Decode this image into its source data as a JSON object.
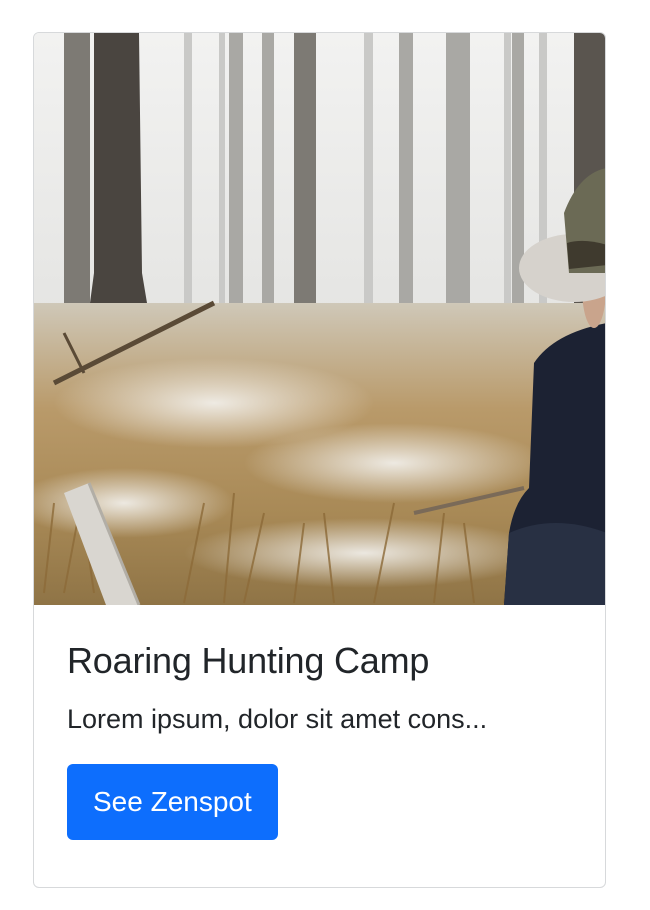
{
  "card": {
    "image_alt": "Person in a hat sitting in a snowy forest",
    "title": "Roaring Hunting Camp",
    "description": "Lorem ipsum, dolor sit amet cons...",
    "button_label": "See Zenspot"
  },
  "colors": {
    "button_bg": "#0d6efd",
    "text": "#212529",
    "border": "#d7d9db"
  }
}
